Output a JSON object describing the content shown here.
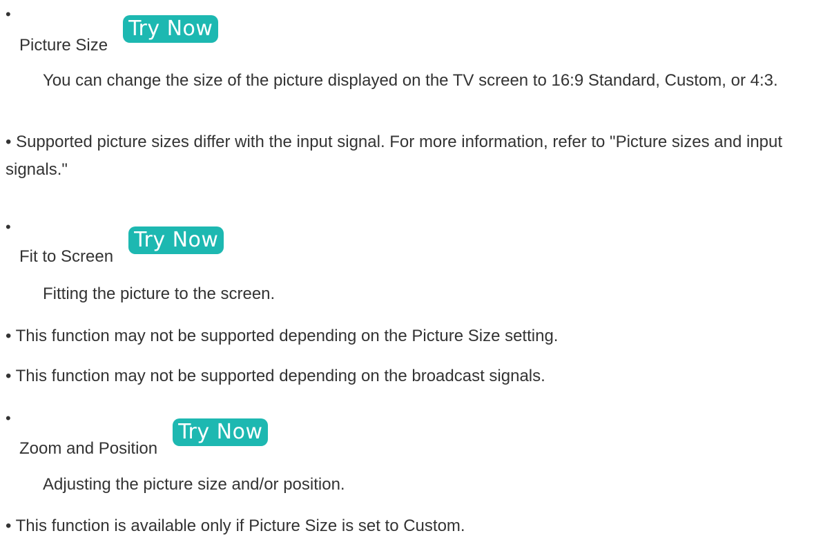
{
  "sections": [
    {
      "heading": "Picture Size",
      "try_now_label": "Try Now",
      "description": "You can change the size of the picture displayed on the TV screen to 16:9 Standard, Custom, or 4:3.",
      "notes": [
        "Supported picture sizes differ with the input signal. For more information, refer to \"Picture sizes and input signals.\""
      ]
    },
    {
      "heading": "Fit to Screen",
      "try_now_label": "Try Now",
      "description": "Fitting the picture to the screen.",
      "notes": [
        "This function may not be supported depending on the Picture Size setting.",
        "This function may not be supported depending on the broadcast signals."
      ]
    },
    {
      "heading": "Zoom and Position",
      "try_now_label": "Try Now",
      "description": "Adjusting the picture size and/or position.",
      "notes": [
        "This function is available only if Picture Size is set to Custom."
      ]
    }
  ],
  "bullet_char": "•",
  "colors": {
    "text": "#333333",
    "try_now_bg": "#1db8b1",
    "try_now_text": "#ffffff"
  }
}
